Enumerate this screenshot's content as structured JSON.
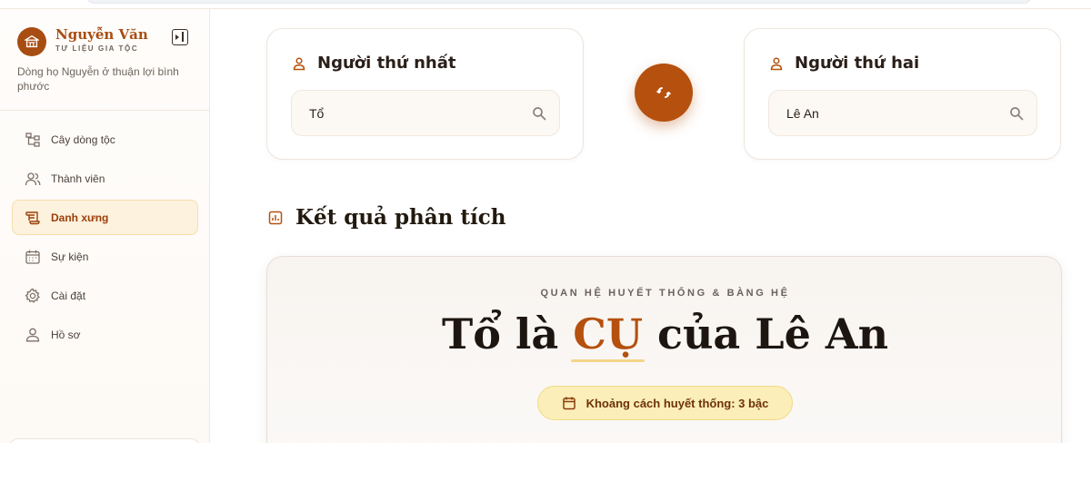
{
  "brand": {
    "title": "Nguyễn Văn",
    "subtitle": "TƯ LIỆU GIA TỘC",
    "description": "Dòng họ Nguyễn ở thuận lợi bình phước"
  },
  "sidebar": {
    "items": [
      {
        "label": "Cây dòng tộc",
        "icon": "tree-icon",
        "active": false
      },
      {
        "label": "Thành viên",
        "icon": "users-icon",
        "active": false
      },
      {
        "label": "Danh xưng",
        "icon": "scroll-icon",
        "active": true
      },
      {
        "label": "Sự kiện",
        "icon": "calendar-icon",
        "active": false
      },
      {
        "label": "Cài đặt",
        "icon": "gear-icon",
        "active": false
      },
      {
        "label": "Hồ sơ",
        "icon": "user-icon",
        "active": false
      }
    ]
  },
  "person1": {
    "label": "Người thứ nhất",
    "value": "Tổ"
  },
  "person2": {
    "label": "Người thứ hai",
    "value": "Lê An"
  },
  "results": {
    "section_title": "Kết quả phân tích",
    "kicker": "QUAN HỆ HUYẾT THỐNG & BÀNG HỆ",
    "subject": "Tổ",
    "connector_1": "là",
    "relation": "CỤ",
    "connector_2": "của",
    "target": "Lê An",
    "distance": "Khoảng cách huyết thống: 3 bậc"
  },
  "colors": {
    "accent": "#b5500e",
    "accent_light": "#fdf2dd",
    "highlight": "#fbeeb8"
  }
}
